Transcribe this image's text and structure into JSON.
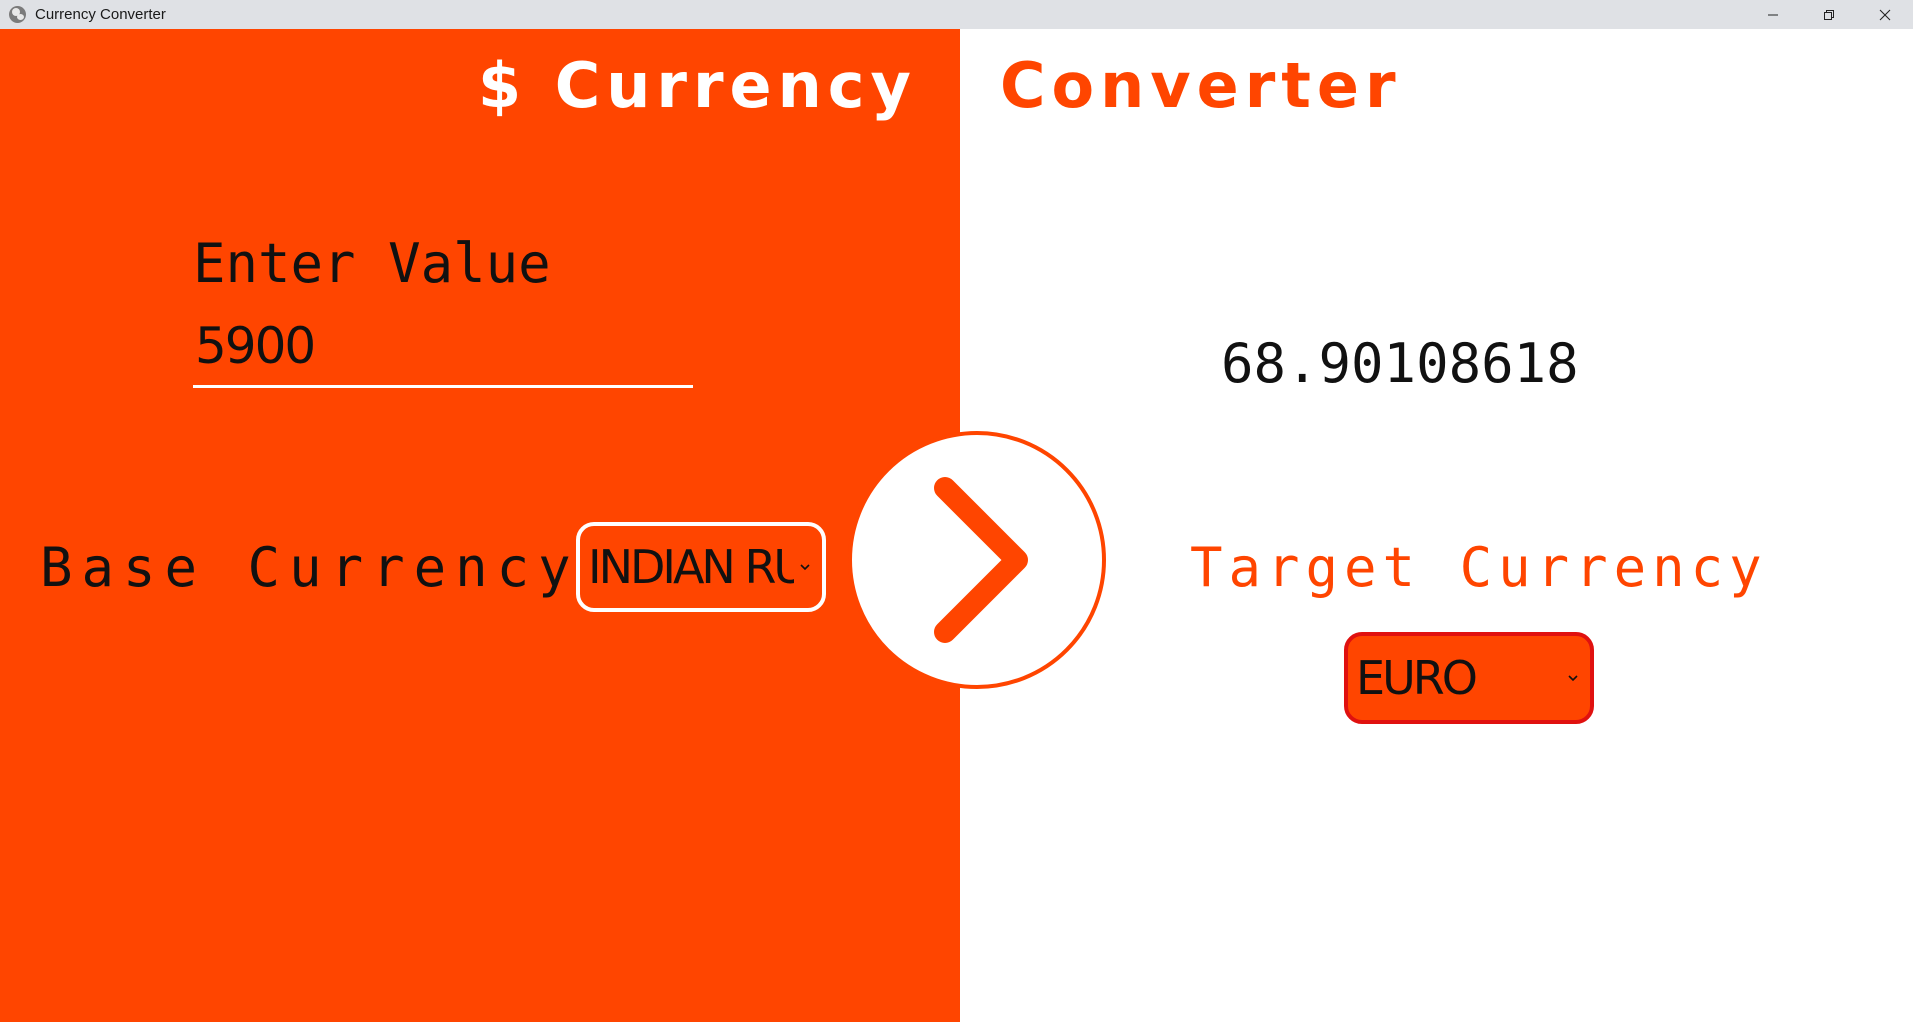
{
  "window": {
    "title": "Currency Converter",
    "icon": "globe-icon",
    "controls": [
      "minimize-icon",
      "restore-icon",
      "close-icon"
    ]
  },
  "heading": {
    "left": "$ Currency",
    "right": "Converter"
  },
  "input": {
    "label": "Enter Value",
    "value": "5900"
  },
  "base": {
    "label": "Base Currency",
    "selected": "INDIAN RUPEE"
  },
  "convert_button": {
    "icon": "chevron-right-icon"
  },
  "result": {
    "value": "68.90108618"
  },
  "target": {
    "label": "Target Currency",
    "selected": "EURO"
  },
  "colors": {
    "accent": "#ff4500",
    "target_border": "#e0110f",
    "text": "#111111",
    "background": "#ffffff"
  }
}
